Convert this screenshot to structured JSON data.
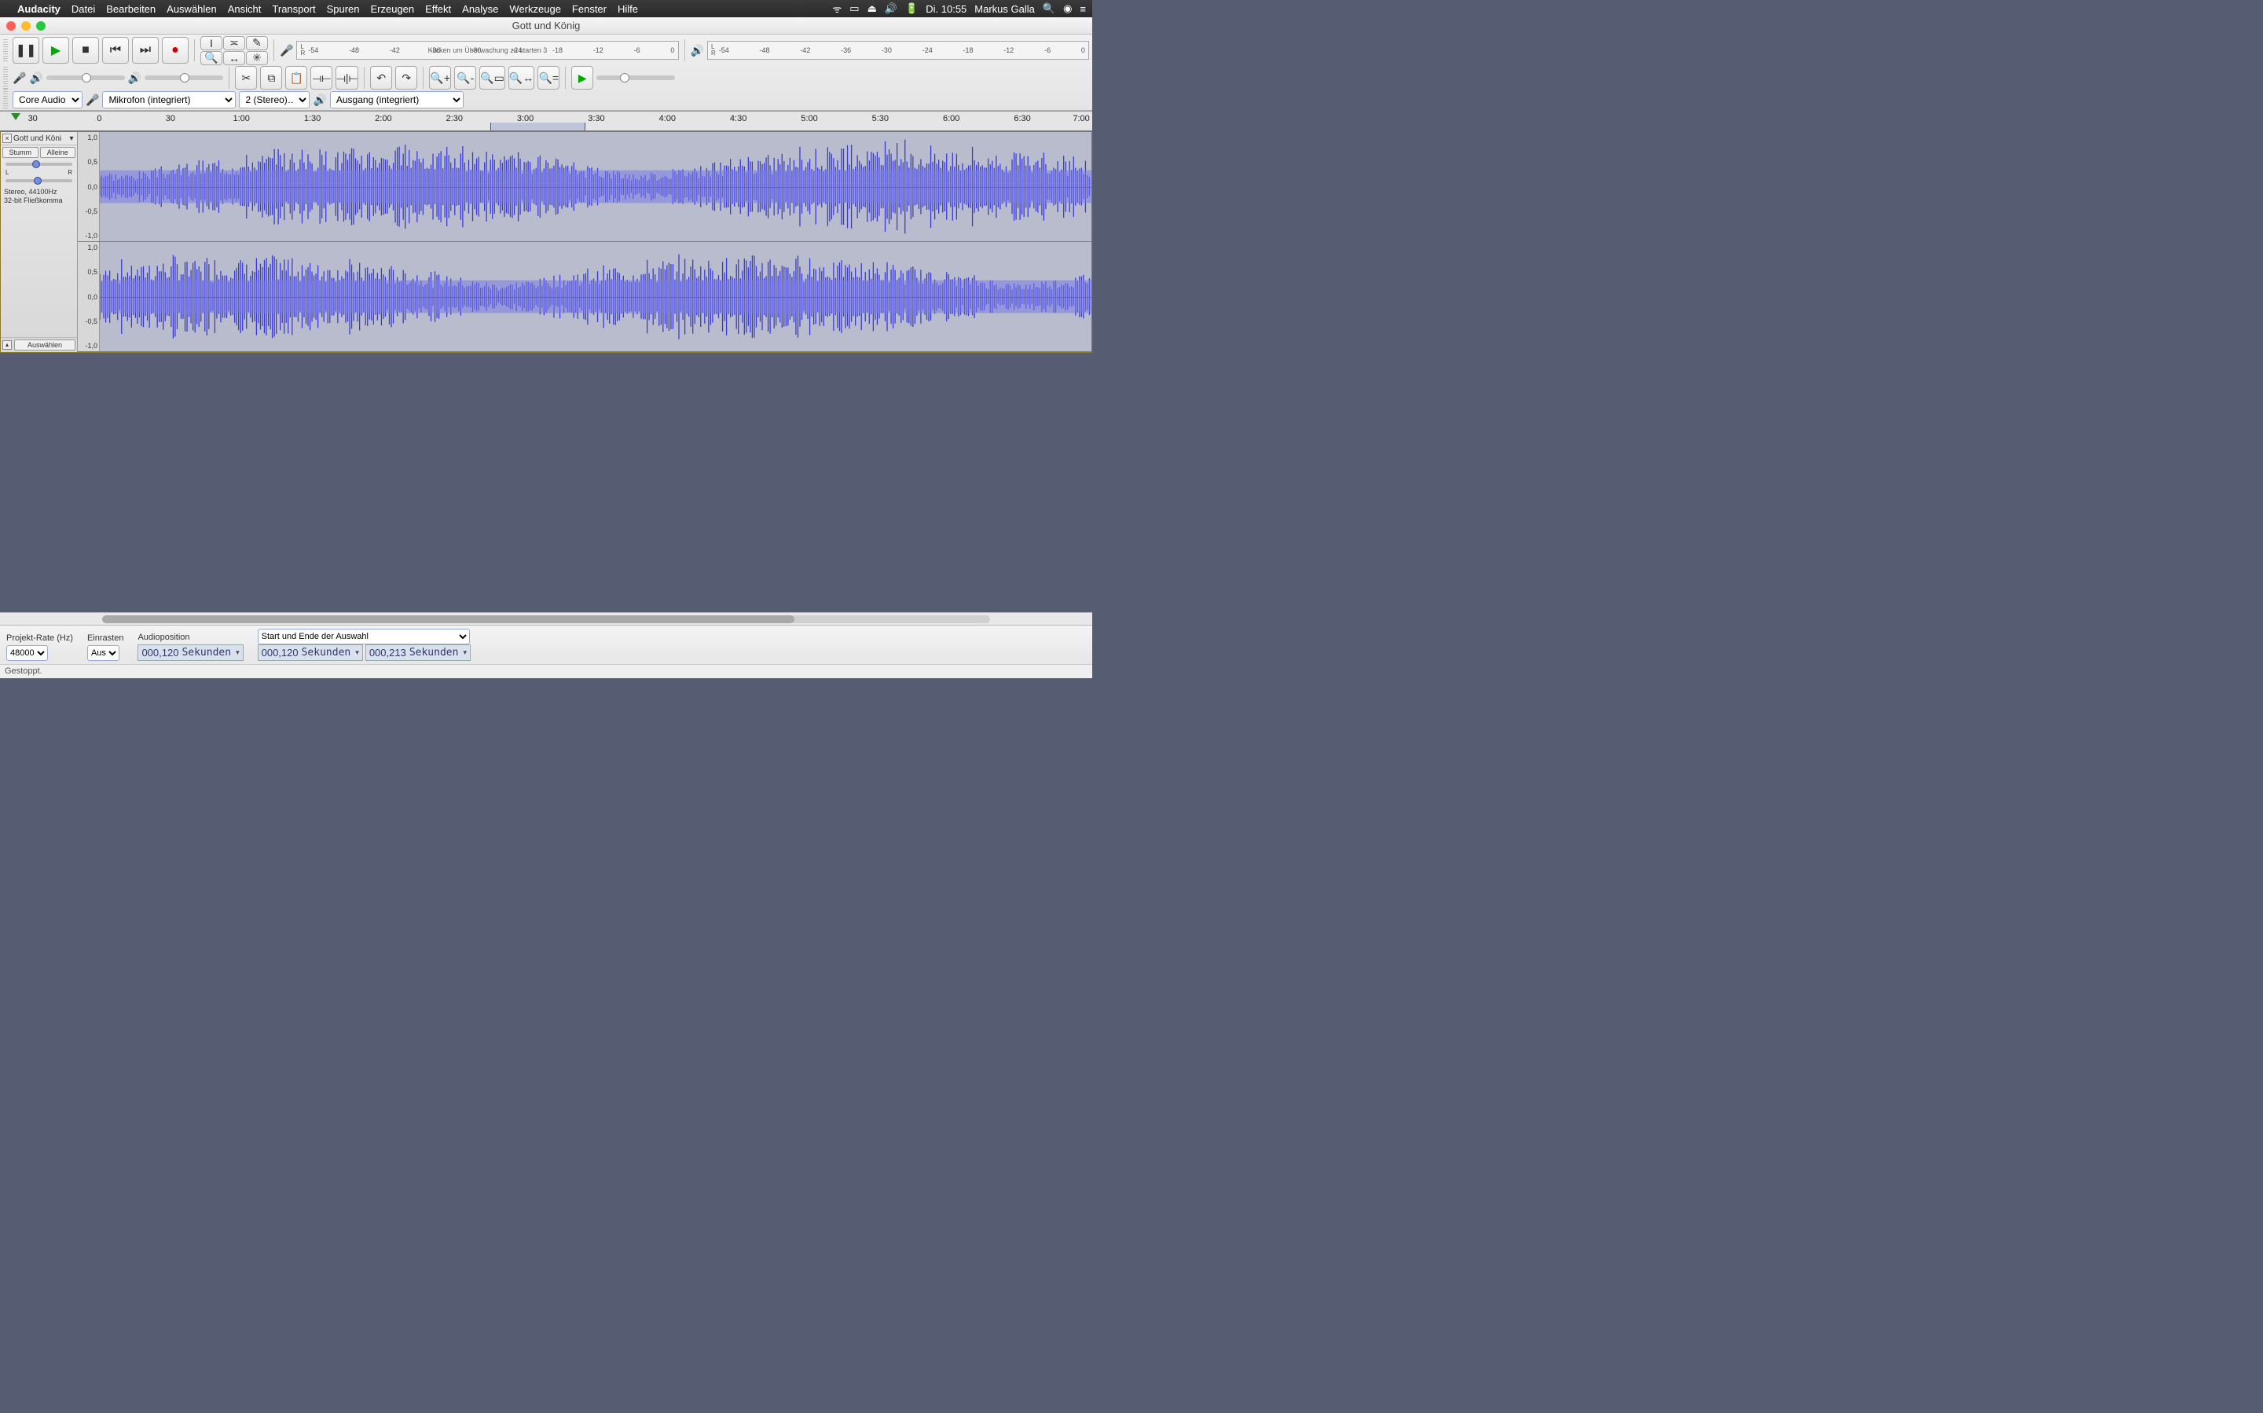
{
  "menubar": {
    "apple": "",
    "app": "Audacity",
    "items": [
      "Datei",
      "Bearbeiten",
      "Auswählen",
      "Ansicht",
      "Transport",
      "Spuren",
      "Erzeugen",
      "Effekt",
      "Analyse",
      "Werkzeuge",
      "Fenster",
      "Hilfe"
    ],
    "right": {
      "time": "Di. 10:55",
      "user": "Markus Galla"
    }
  },
  "window": {
    "title": "Gott und König"
  },
  "toolbar": {
    "transport": {
      "pause": "❚❚",
      "play": "▶",
      "stop": "■",
      "skip_start": "⏮",
      "skip_end": "⏭",
      "record": "●"
    },
    "tools": {
      "select": "Ⓘ",
      "envelope": "⌖",
      "draw": "✎",
      "zoom": "🔍",
      "timeshift": "↔",
      "multi": "✳"
    },
    "meter_ticks": [
      "-54",
      "-48",
      "-42",
      "-36",
      "-30",
      "-24",
      "-18",
      "-12",
      "-6",
      "0"
    ],
    "rec_meter_hint": "Klicken um Überwachung zu starten 3",
    "lr": "L\nR",
    "edit": {
      "cut": "✂",
      "copy": "⧉",
      "paste": "📋",
      "trim": "�裁",
      "silence": "📄",
      "undo": "↶",
      "redo": "↷"
    },
    "zoom": {
      "in": "🔍+",
      "out": "🔍-",
      "sel": "🔍[",
      "fit": "🔍=",
      "toggle": "🔍↔"
    },
    "play_at_speed": "▶",
    "device": {
      "host": "Core Audio",
      "rec": "Mikrofon (integriert)",
      "channels": "2 (Stereo)…",
      "play": "Ausgang (integriert)"
    }
  },
  "timeline": {
    "labels": [
      "30",
      "0",
      "30",
      "1:00",
      "1:30",
      "2:00",
      "2:30",
      "3:00",
      "3:30",
      "4:00",
      "4:30",
      "5:00",
      "5:30",
      "6:00",
      "6:30",
      "7:00"
    ],
    "selection": {
      "start_pct": 44.9,
      "end_pct": 53.6
    }
  },
  "track": {
    "name": "Gott und Köni",
    "mute": "Stumm",
    "solo": "Alleine",
    "l": "L",
    "r": "R",
    "info1": "Stereo, 44100Hz",
    "info2": "32-bit Fließkomma",
    "select": "Auswählen",
    "amp": [
      "1,0",
      "0,5",
      "0,0",
      "-0,5",
      "-1,0"
    ]
  },
  "bottom": {
    "rate_label": "Projekt-Rate (Hz)",
    "rate": "48000",
    "snap_label": "Einrasten",
    "snap": "Aus",
    "pos_label": "Audioposition",
    "sel_mode": "Start und Ende der Auswahl",
    "pos": "000,120",
    "pos_unit": "Sekunden",
    "sel_start": "000,120",
    "sel_start_unit": "Sekunden",
    "sel_end": "000,213",
    "sel_end_unit": "Sekunden"
  },
  "status": "Gestoppt."
}
